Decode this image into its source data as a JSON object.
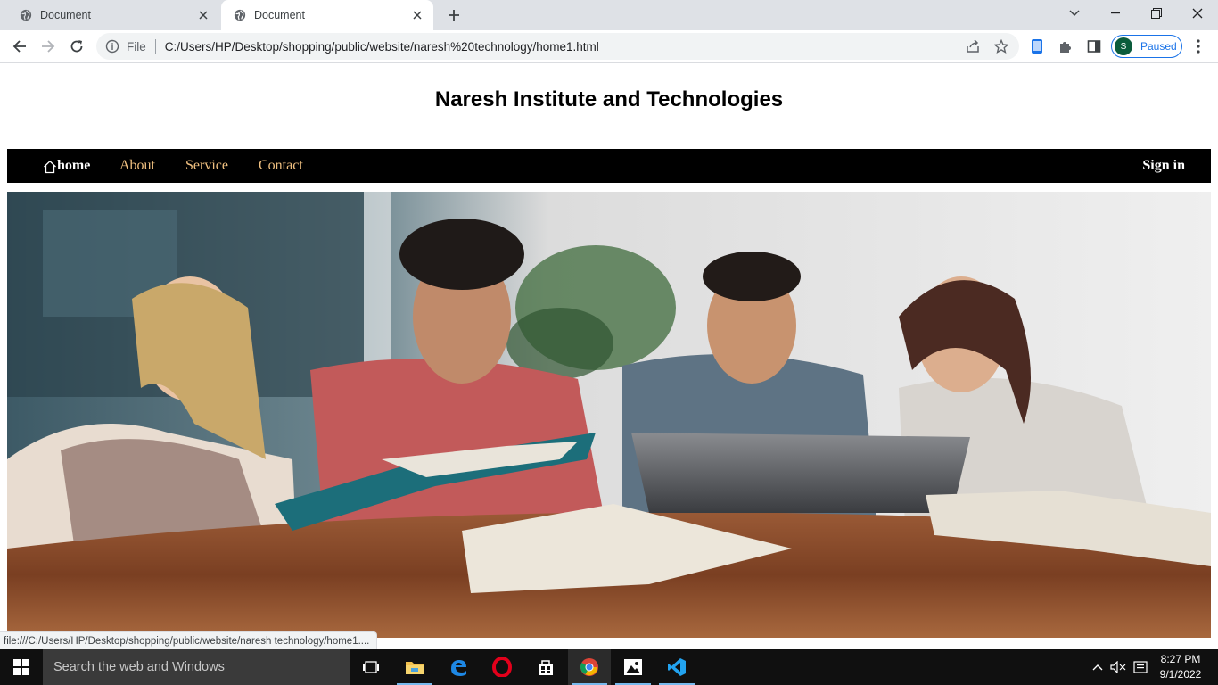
{
  "browser": {
    "tabs": [
      {
        "title": "Document",
        "active": false
      },
      {
        "title": "Document",
        "active": true
      }
    ],
    "omnibox": {
      "scheme_label": "File",
      "url": "C:/Users/HP/Desktop/shopping/public/website/naresh%20technology/home1.html"
    },
    "profile": {
      "initial": "S",
      "status": "Paused"
    },
    "status_url": "file:///C:/Users/HP/Desktop/shopping/public/website/naresh technology/home1...."
  },
  "page": {
    "title": "Naresh Institute and Technologies",
    "nav": {
      "home": "home",
      "about": "About",
      "service": "Service",
      "contact": "Contact",
      "signin": "Sign in"
    },
    "hero": {
      "icon": "students-studying-photo"
    }
  },
  "taskbar": {
    "search_placeholder": "Search the web and Windows",
    "apps": [
      "task-view-icon",
      "file-explorer-icon",
      "edge-icon",
      "opera-icon",
      "store-icon",
      "chrome-icon",
      "photos-icon",
      "vscode-icon"
    ],
    "time": "8:27 PM",
    "date": "9/1/2022"
  },
  "colors": {
    "nav_bg": "#000000",
    "nav_link": "#f0c080",
    "tab_strip": "#dee1e6",
    "taskbar": "#101010",
    "profile_accent": "#1a73e8"
  }
}
